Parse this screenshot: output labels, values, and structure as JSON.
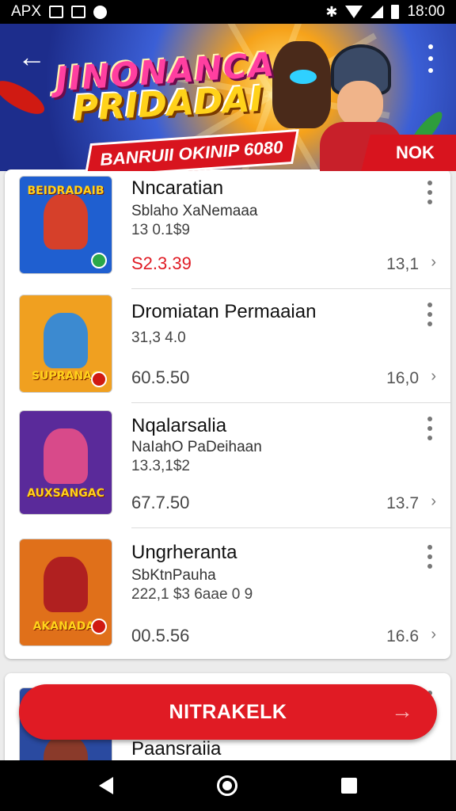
{
  "status_bar": {
    "carrier": "APX",
    "time": "18:00",
    "icons": [
      "image-icon",
      "photo-icon",
      "notification-icon",
      "bluetooth-icon",
      "wifi-icon",
      "signal-icon",
      "battery-icon"
    ]
  },
  "banner": {
    "title_line1": "JINONANCA",
    "title_line2": "PRIDADAI",
    "ribbon_text": "BANRUII OKINIP 6080",
    "ribbon_right": "NOK",
    "back_icon": "back-arrow-icon",
    "menu_icon": "more-vert-icon"
  },
  "items": [
    {
      "title": "Nncaratian",
      "subtitle": "Sblaho XaNemaaa",
      "meta": "13 0.1$9",
      "price": "S2.3.39",
      "price_red": true,
      "count": "13,1",
      "thumb_text": "BEIDRADAIB",
      "thumb_bg": "#1f5fd0",
      "thumb_fig": "#d6402a"
    },
    {
      "title": "Dromiatan Permaaian",
      "subtitle": "",
      "meta": "31,3 4.0",
      "price": "60.5.50",
      "price_red": false,
      "count": "16,0",
      "thumb_text": "SUPRANAS",
      "thumb_bg": "#f0a020",
      "thumb_fig": "#3c8ad0"
    },
    {
      "title": "Nqalarsalia",
      "subtitle": "NaIahO PaDeihaan",
      "meta": "13.3,1$2",
      "price": "67.7.50",
      "price_red": false,
      "count": "13.7",
      "thumb_text": "AUXSANGAC",
      "thumb_bg": "#5a2a9a",
      "thumb_fig": "#d84a8a"
    },
    {
      "title": "Ungrheranta",
      "subtitle": "SbKtnPauha",
      "meta": "222,1 $3  6aae 0 9",
      "price": "00.5.56",
      "price_red": false,
      "count": "16.6",
      "thumb_text": "AKANADAI",
      "thumb_bg": "#e0701a",
      "thumb_fig": "#b02020"
    }
  ],
  "partial_item": {
    "title": "Paansraiia"
  },
  "cta": {
    "label": "NITRAKELK",
    "arrow_icon": "arrow-right-icon"
  },
  "colors": {
    "accent_red": "#e01b24",
    "status_bar": "#000000",
    "card_bg": "#ffffff",
    "page_bg": "#ececec"
  }
}
